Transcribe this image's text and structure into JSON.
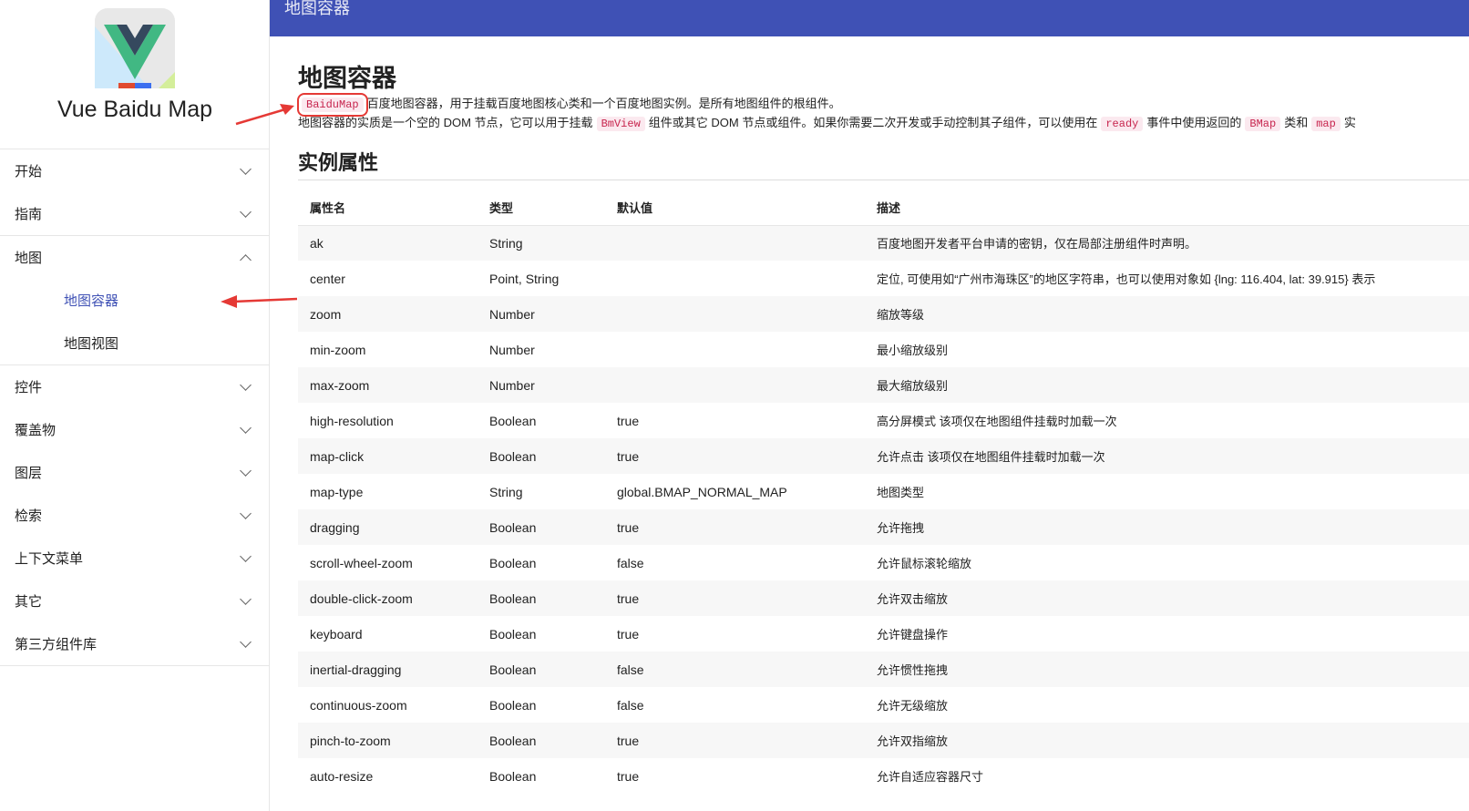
{
  "brand": "Vue Baidu Map",
  "topbar_title": "地图容器",
  "nav": [
    {
      "label": "开始",
      "expanded": false
    },
    {
      "label": "指南",
      "expanded": false
    },
    {
      "label": "地图",
      "expanded": true,
      "items": [
        {
          "label": "地图容器",
          "active": true
        },
        {
          "label": "地图视图",
          "active": false
        }
      ]
    },
    {
      "label": "控件",
      "expanded": false
    },
    {
      "label": "覆盖物",
      "expanded": false
    },
    {
      "label": "图层",
      "expanded": false
    },
    {
      "label": "检索",
      "expanded": false
    },
    {
      "label": "上下文菜单",
      "expanded": false
    },
    {
      "label": "其它",
      "expanded": false
    },
    {
      "label": "第三方组件库",
      "expanded": false
    }
  ],
  "page": {
    "title": "地图容器",
    "intro": {
      "code": "BaiduMap",
      "text": "百度地图容器，用于挂载百度地图核心类和一个百度地图实例。是所有地图组件的根组件。"
    },
    "desc": {
      "t1": "地图容器的实质是一个空的 DOM 节点，它可以用于挂载",
      "c1": "BmView",
      "t2": "组件或其它 DOM 节点或组件。如果你需要二次开发或手动控制其子组件，可以使用在",
      "c2": "ready",
      "t3": "事件中使用返回的",
      "c3": "BMap",
      "t4": "类和",
      "c4": "map",
      "t5": "实"
    },
    "section": "实例属性",
    "columns": [
      "属性名",
      "类型",
      "默认值",
      "描述"
    ],
    "rows": [
      [
        "ak",
        "String",
        "",
        "百度地图开发者平台申请的密钥，仅在局部注册组件时声明。"
      ],
      [
        "center",
        "Point, String",
        "",
        "定位, 可使用如“广州市海珠区”的地区字符串，也可以使用对象如 {lng: 116.404, lat: 39.915} 表示"
      ],
      [
        "zoom",
        "Number",
        "",
        "缩放等级"
      ],
      [
        "min-zoom",
        "Number",
        "",
        "最小缩放级别"
      ],
      [
        "max-zoom",
        "Number",
        "",
        "最大缩放级别"
      ],
      [
        "high-resolution",
        "Boolean",
        "true",
        "高分屏模式 该项仅在地图组件挂载时加载一次"
      ],
      [
        "map-click",
        "Boolean",
        "true",
        "允许点击 该项仅在地图组件挂载时加载一次"
      ],
      [
        "map-type",
        "String",
        "global.BMAP_NORMAL_MAP",
        "地图类型"
      ],
      [
        "dragging",
        "Boolean",
        "true",
        "允许拖拽"
      ],
      [
        "scroll-wheel-zoom",
        "Boolean",
        "false",
        "允许鼠标滚轮缩放"
      ],
      [
        "double-click-zoom",
        "Boolean",
        "true",
        "允许双击缩放"
      ],
      [
        "keyboard",
        "Boolean",
        "true",
        "允许键盘操作"
      ],
      [
        "inertial-dragging",
        "Boolean",
        "false",
        "允许惯性拖拽"
      ],
      [
        "continuous-zoom",
        "Boolean",
        "false",
        "允许无级缩放"
      ],
      [
        "pinch-to-zoom",
        "Boolean",
        "true",
        "允许双指缩放"
      ],
      [
        "auto-resize",
        "Boolean",
        "true",
        "允许自适应容器尺寸"
      ]
    ]
  },
  "colors": {
    "accent": "#3f51b5",
    "annotation": "#e53935"
  }
}
